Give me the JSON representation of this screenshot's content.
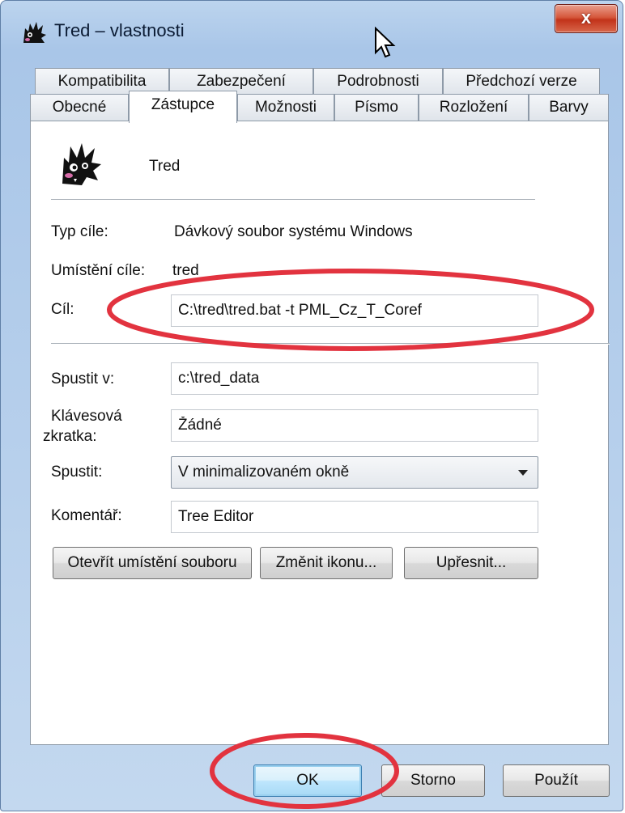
{
  "window": {
    "title": "Tred – vlastnosti",
    "close_label": "x"
  },
  "tabs": {
    "row1": [
      "Kompatibilita",
      "Zabezpečení",
      "Podrobnosti",
      "Předchozí verze"
    ],
    "row2": [
      "Obecné",
      "Zástupce",
      "Možnosti",
      "Písmo",
      "Rozložení",
      "Barvy"
    ],
    "active": "Zástupce"
  },
  "shortcut": {
    "name": "Tred",
    "target_type_label": "Typ cíle:",
    "target_type_value": "Dávkový soubor systému Windows",
    "target_location_label": "Umístění cíle:",
    "target_location_value": "tred",
    "target_label": "Cíl:",
    "target_value": "C:\\tred\\tred.bat -t PML_Cz_T_Coref",
    "start_in_label": "Spustit v:",
    "start_in_value": "c:\\tred_data",
    "hotkey_label_line1": "Klávesová",
    "hotkey_label_line2": "zkratka:",
    "hotkey_value": "Žádné",
    "run_label": "Spustit:",
    "run_value": "V minimalizovaném okně",
    "comment_label": "Komentář:",
    "comment_value": "Tree Editor"
  },
  "buttons": {
    "open_location": "Otevřít umístění souboru",
    "change_icon": "Změnit ikonu...",
    "advanced": "Upřesnit...",
    "ok": "OK",
    "cancel": "Storno",
    "apply": "Použít"
  },
  "colors": {
    "highlight_ellipse": "#e2333f",
    "title_bar": "#a9c6e8"
  },
  "icons": {
    "app": "cat-icon",
    "close": "close-icon",
    "cursor": "mouse-cursor-icon",
    "dropdown": "chevron-down-icon"
  }
}
